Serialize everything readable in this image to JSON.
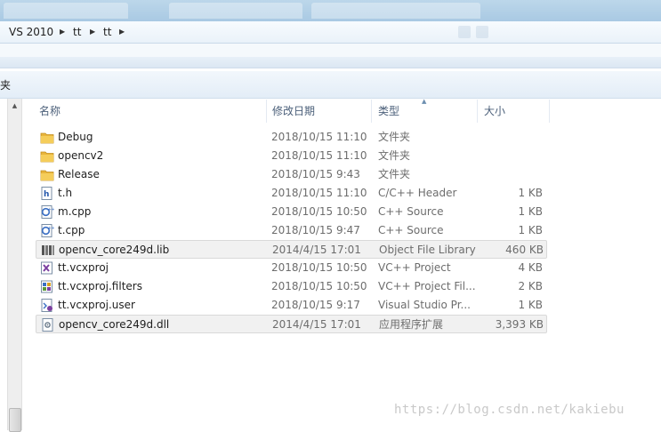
{
  "breadcrumb": {
    "items": [
      "VS 2010",
      "tt",
      "tt"
    ]
  },
  "favorites": {
    "label": "夹"
  },
  "columns": {
    "name": "名称",
    "date": "修改日期",
    "type": "类型",
    "size": "大小"
  },
  "files": [
    {
      "name": "Debug",
      "date": "2018/10/15 11:10",
      "type": "文件夹",
      "size": "",
      "icon": "folder-icon"
    },
    {
      "name": "opencv2",
      "date": "2018/10/15 11:10",
      "type": "文件夹",
      "size": "",
      "icon": "folder-icon"
    },
    {
      "name": "Release",
      "date": "2018/10/15 9:43",
      "type": "文件夹",
      "size": "",
      "icon": "folder-icon"
    },
    {
      "name": "t.h",
      "date": "2018/10/15 11:10",
      "type": "C/C++ Header",
      "size": "1 KB",
      "icon": "header-file-icon"
    },
    {
      "name": "m.cpp",
      "date": "2018/10/15 10:50",
      "type": "C++ Source",
      "size": "1 KB",
      "icon": "cpp-file-icon"
    },
    {
      "name": "t.cpp",
      "date": "2018/10/15 9:47",
      "type": "C++ Source",
      "size": "1 KB",
      "icon": "cpp-file-icon"
    },
    {
      "name": "opencv_core249d.lib",
      "date": "2014/4/15 17:01",
      "type": "Object File Library",
      "size": "460 KB",
      "icon": "lib-file-icon"
    },
    {
      "name": "tt.vcxproj",
      "date": "2018/10/15 10:50",
      "type": "VC++ Project",
      "size": "4 KB",
      "icon": "vcxproj-file-icon"
    },
    {
      "name": "tt.vcxproj.filters",
      "date": "2018/10/15 10:50",
      "type": "VC++ Project Fil...",
      "size": "2 KB",
      "icon": "filters-file-icon"
    },
    {
      "name": "tt.vcxproj.user",
      "date": "2018/10/15 9:17",
      "type": "Visual Studio Pr...",
      "size": "1 KB",
      "icon": "user-file-icon"
    },
    {
      "name": "opencv_core249d.dll",
      "date": "2014/4/15 17:01",
      "type": "应用程序扩展",
      "size": "3,393 KB",
      "icon": "dll-file-icon"
    }
  ],
  "watermark": "https://blog.csdn.net/kakiebu",
  "colors": {
    "folder": "#e8b53c",
    "selection": "#f1f1f1",
    "header_text": "#4c607a"
  }
}
